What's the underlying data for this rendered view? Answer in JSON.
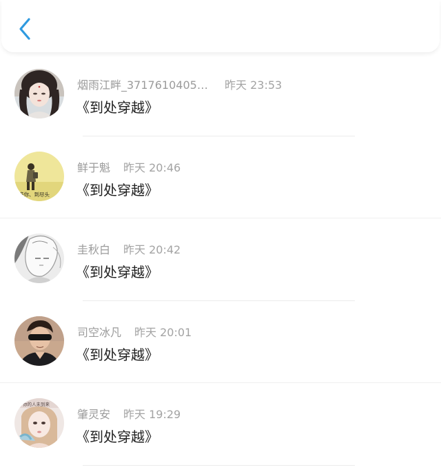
{
  "header": {
    "back_icon": "chevron-left-icon",
    "accent_color": "#2f9ae0"
  },
  "messages": [
    {
      "username": "烟雨江畔_37176104057...",
      "time": "昨天 23:53",
      "content": "《到处穿越》"
    },
    {
      "username": "鲜于魁",
      "time": "昨天 20:46",
      "content": "《到处穿越》"
    },
    {
      "username": "圭秋白",
      "time": "昨天 20:42",
      "content": "《到处穿越》"
    },
    {
      "username": "司空冰凡",
      "time": "昨天 20:01",
      "content": "《到处穿越》"
    },
    {
      "username": "肇灵安",
      "time": "昨天 19:29",
      "content": "《到处穿越》"
    }
  ]
}
